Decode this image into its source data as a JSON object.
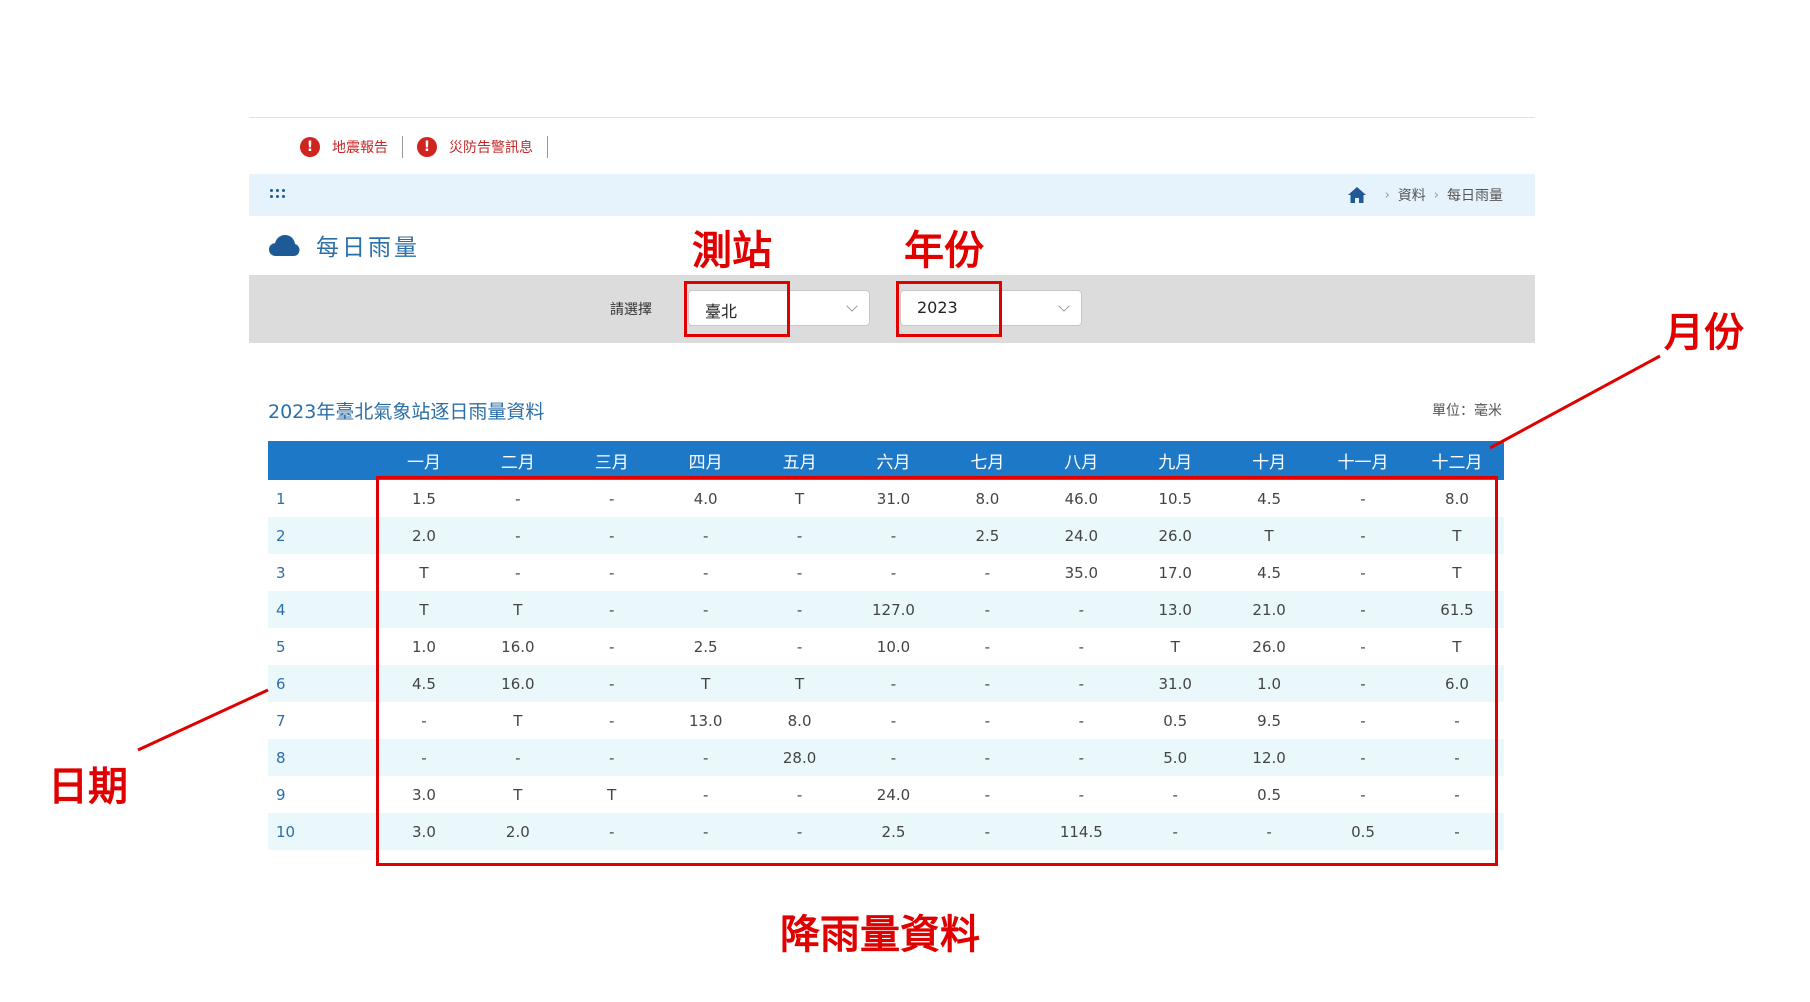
{
  "alerts": [
    {
      "label": "地震報告",
      "icon": "alert-icon"
    },
    {
      "label": "災防告警訊息",
      "icon": "alert-icon"
    }
  ],
  "breadcrumb": {
    "home_icon": "home-icon",
    "items": [
      "資料",
      "每日雨量"
    ]
  },
  "page": {
    "title": "每日雨量",
    "icon": "cloud-icon"
  },
  "filter": {
    "label": "請選擇",
    "station": "臺北",
    "year": "2023"
  },
  "table": {
    "caption": "2023年臺北氣象站逐日雨量資料",
    "unit": "單位：毫米",
    "months": [
      "一月",
      "二月",
      "三月",
      "四月",
      "五月",
      "六月",
      "七月",
      "八月",
      "九月",
      "十月",
      "十一月",
      "十二月"
    ],
    "rows": [
      {
        "day": "1",
        "values": [
          "1.5",
          "-",
          "-",
          "4.0",
          "T",
          "31.0",
          "8.0",
          "46.0",
          "10.5",
          "4.5",
          "-",
          "8.0"
        ]
      },
      {
        "day": "2",
        "values": [
          "2.0",
          "-",
          "-",
          "-",
          "-",
          "-",
          "2.5",
          "24.0",
          "26.0",
          "T",
          "-",
          "T"
        ]
      },
      {
        "day": "3",
        "values": [
          "T",
          "-",
          "-",
          "-",
          "-",
          "-",
          "-",
          "35.0",
          "17.0",
          "4.5",
          "-",
          "T"
        ]
      },
      {
        "day": "4",
        "values": [
          "T",
          "T",
          "-",
          "-",
          "-",
          "127.0",
          "-",
          "-",
          "13.0",
          "21.0",
          "-",
          "61.5"
        ]
      },
      {
        "day": "5",
        "values": [
          "1.0",
          "16.0",
          "-",
          "2.5",
          "-",
          "10.0",
          "-",
          "-",
          "T",
          "26.0",
          "-",
          "T"
        ]
      },
      {
        "day": "6",
        "values": [
          "4.5",
          "16.0",
          "-",
          "T",
          "T",
          "-",
          "-",
          "-",
          "31.0",
          "1.0",
          "-",
          "6.0"
        ]
      },
      {
        "day": "7",
        "values": [
          "-",
          "T",
          "-",
          "13.0",
          "8.0",
          "-",
          "-",
          "-",
          "0.5",
          "9.5",
          "-",
          "-"
        ]
      },
      {
        "day": "8",
        "values": [
          "-",
          "-",
          "-",
          "-",
          "28.0",
          "-",
          "-",
          "-",
          "5.0",
          "12.0",
          "-",
          "-"
        ]
      },
      {
        "day": "9",
        "values": [
          "3.0",
          "T",
          "T",
          "-",
          "-",
          "24.0",
          "-",
          "-",
          "-",
          "0.5",
          "-",
          "-"
        ]
      },
      {
        "day": "10",
        "values": [
          "3.0",
          "2.0",
          "-",
          "-",
          "-",
          "2.5",
          "-",
          "114.5",
          "-",
          "-",
          "0.5",
          "-"
        ]
      }
    ]
  },
  "annotations": {
    "station": "測站",
    "year": "年份",
    "month": "月份",
    "date": "日期",
    "rain_data": "降雨量資料",
    "color": "#e00000"
  },
  "colors": {
    "header_blue": "#1e78c8",
    "link_blue": "#2b6fa8",
    "crumb_bg": "#e6f3fc",
    "filter_bg": "#dcdcdc",
    "alert_red": "#d0251f"
  }
}
